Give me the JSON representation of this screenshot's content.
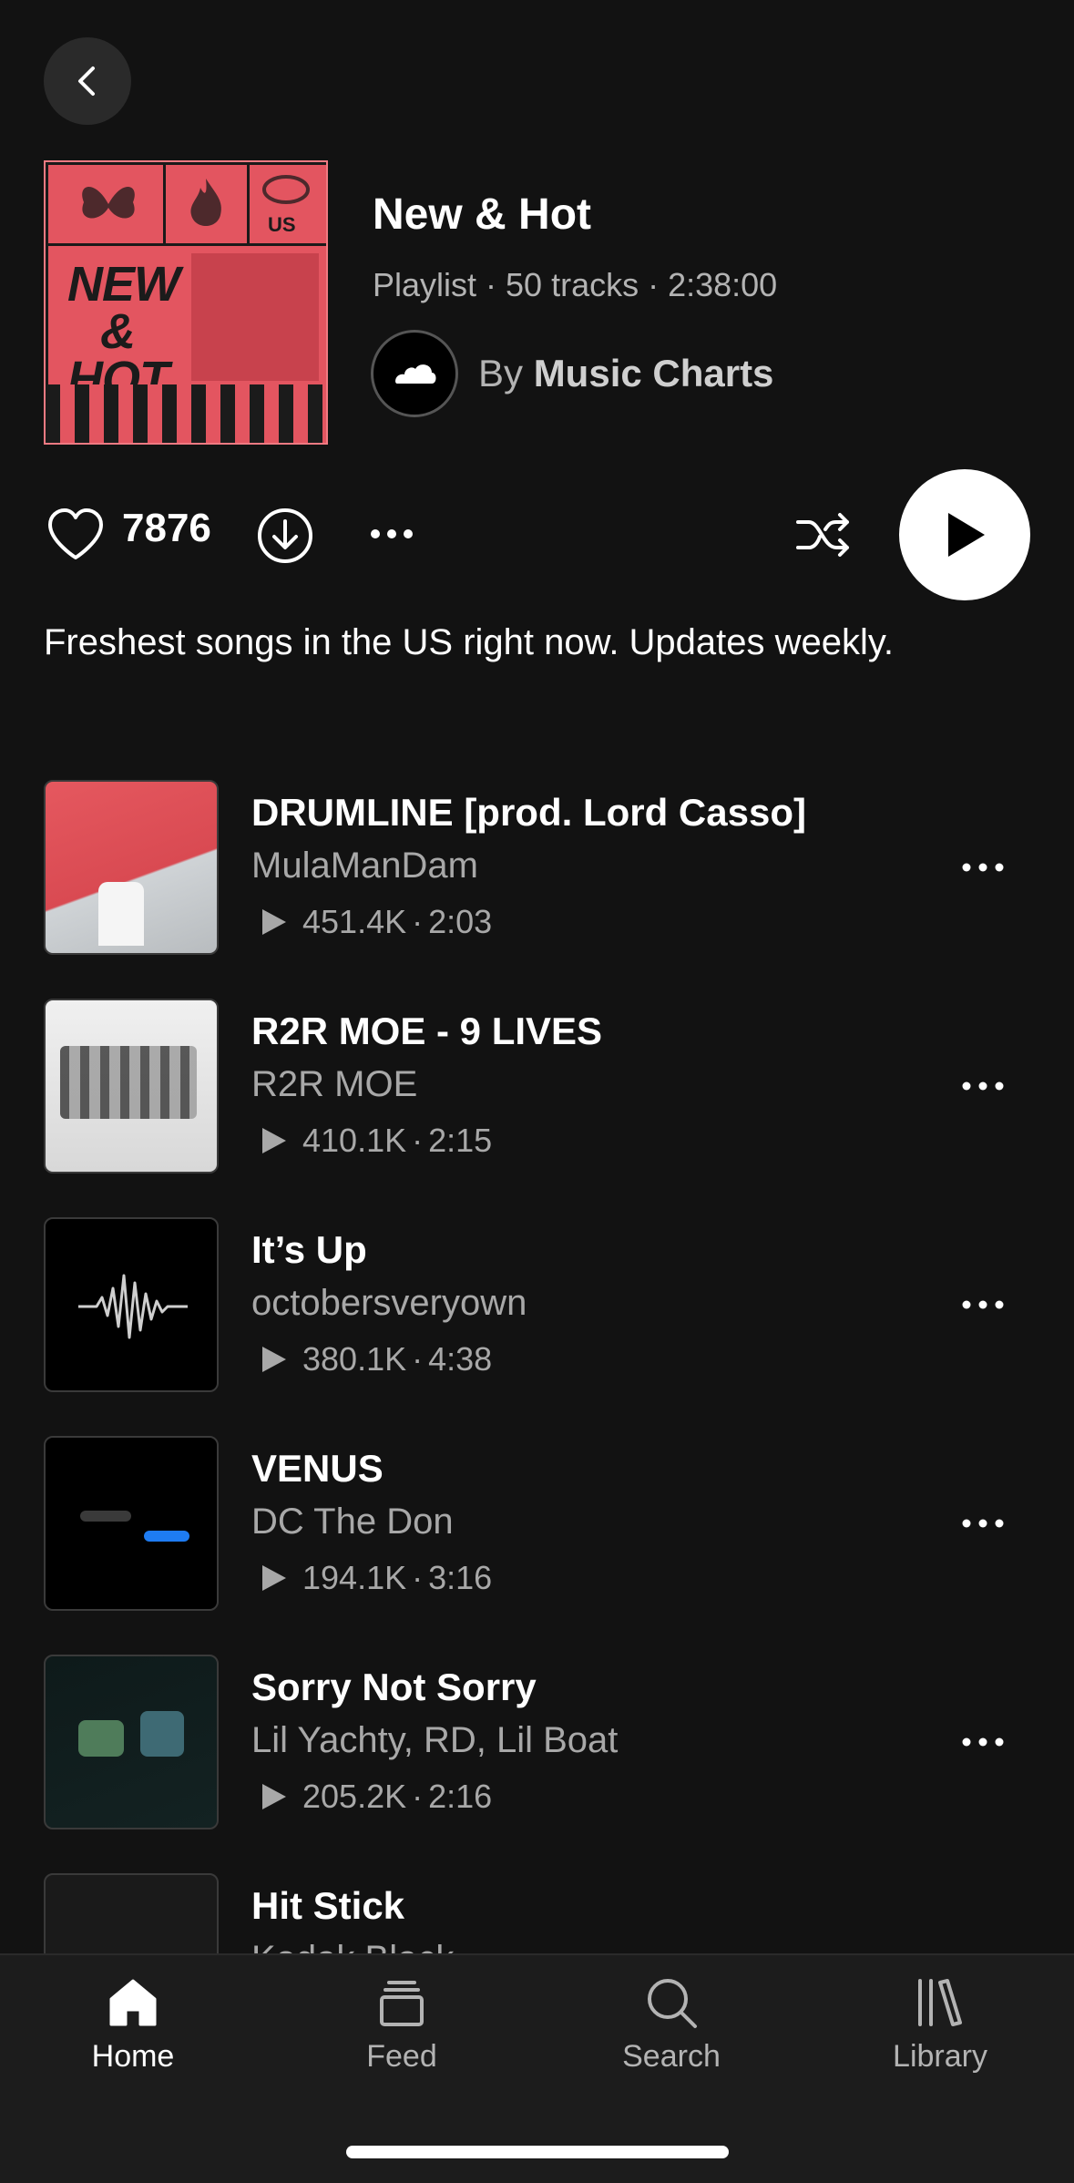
{
  "playlist": {
    "title": "New & Hot",
    "type": "Playlist",
    "tracks_count": "50 tracks",
    "duration": "2:38:00",
    "by_label": "By",
    "owner": "Music Charts",
    "cover_text": "NEW & HOT",
    "cover_region": "US",
    "description": "Freshest songs in the US right now. Updates weekly."
  },
  "actions": {
    "like_count": "7876"
  },
  "tracks": [
    {
      "title": "DRUMLINE [prod. Lord Casso]",
      "artist": "MulaManDam",
      "plays": "451.4K",
      "length": "2:03"
    },
    {
      "title": "R2R MOE - 9 LIVES",
      "artist": "R2R MOE",
      "plays": "410.1K",
      "length": "2:15"
    },
    {
      "title": "It’s Up",
      "artist": "octobersveryown",
      "plays": "380.1K",
      "length": "4:38"
    },
    {
      "title": "VENUS",
      "artist": "DC The Don",
      "plays": "194.1K",
      "length": "3:16"
    },
    {
      "title": "Sorry Not Sorry",
      "artist": "Lil Yachty, RD, Lil Boat",
      "plays": "205.2K",
      "length": "2:16"
    },
    {
      "title": "Hit Stick",
      "artist": "Kodak Black",
      "plays": "",
      "length": ""
    }
  ],
  "nav": {
    "home": "Home",
    "feed": "Feed",
    "search": "Search",
    "library": "Library"
  },
  "colors": {
    "background": "#121212",
    "cover_red": "#e35560",
    "secondary_text": "#a8a8a8"
  }
}
